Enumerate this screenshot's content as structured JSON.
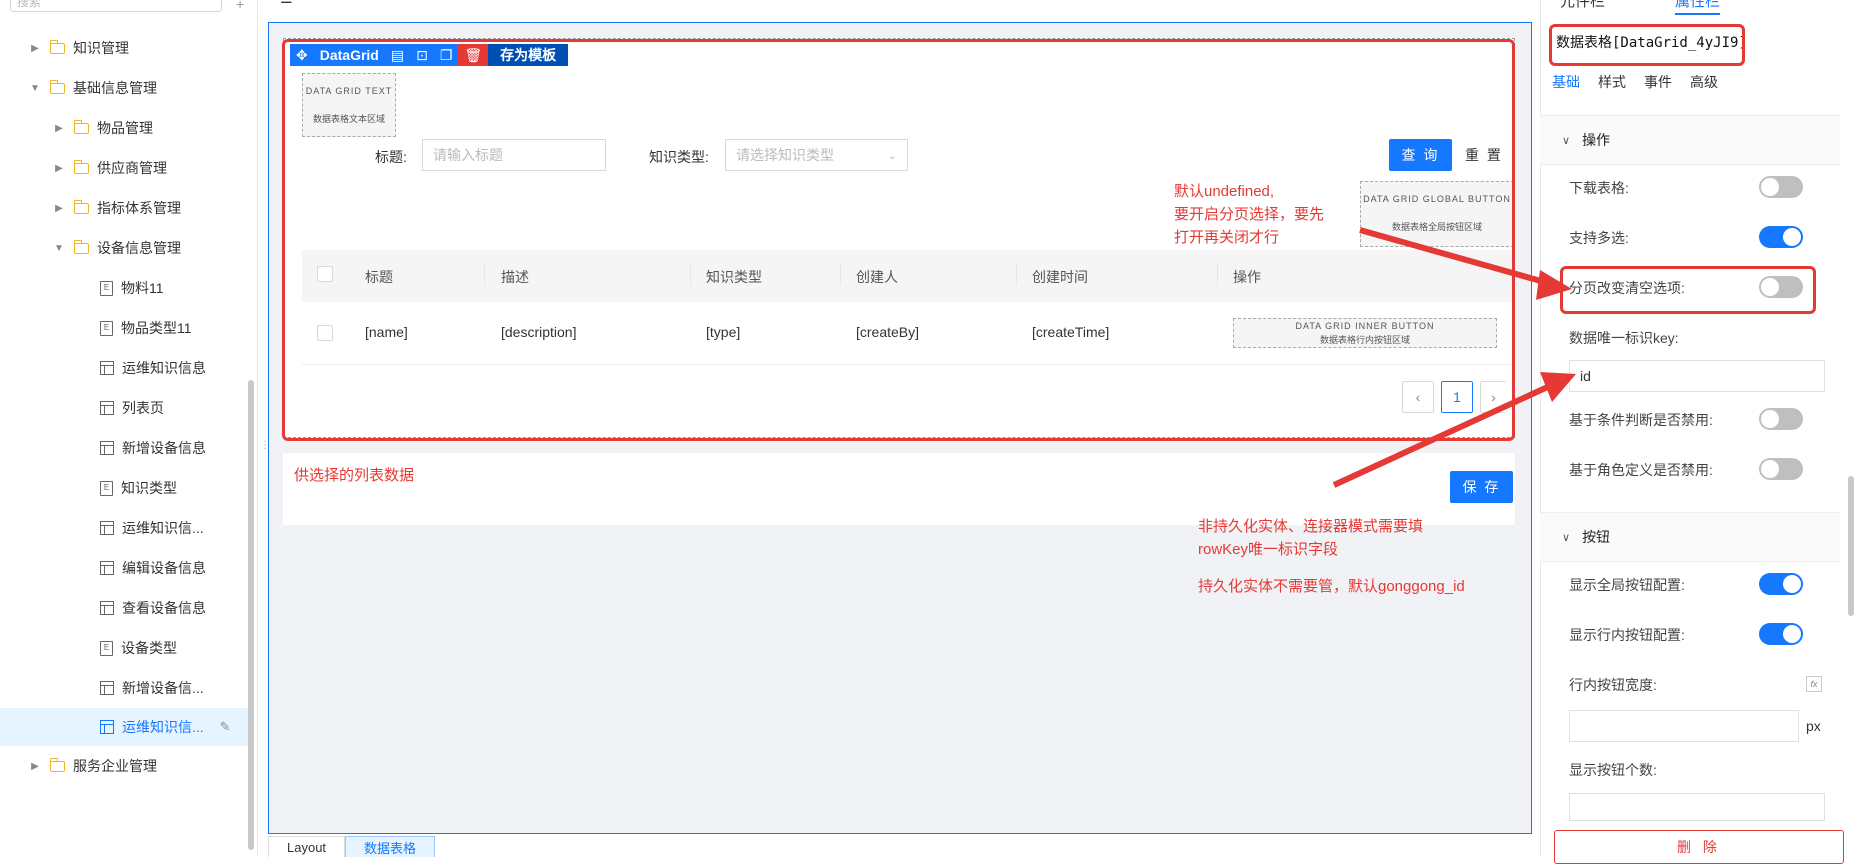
{
  "tree": {
    "search_placeholder": "搜索",
    "add_symbol": "+",
    "items": [
      {
        "label": "知识管理",
        "arrow": "▶",
        "type": "folder"
      },
      {
        "label": "基础信息管理",
        "arrow": "▼",
        "type": "folder"
      },
      {
        "label": "物品管理",
        "arrow": "▶",
        "type": "folder"
      },
      {
        "label": "供应商管理",
        "arrow": "▶",
        "type": "folder"
      },
      {
        "label": "指标体系管理",
        "arrow": "▶",
        "type": "folder"
      },
      {
        "label": "设备信息管理",
        "arrow": "▼",
        "type": "folder"
      },
      {
        "label": "物料11",
        "type": "entity"
      },
      {
        "label": "物品类型11",
        "type": "entity"
      },
      {
        "label": "运维知识信息",
        "type": "page"
      },
      {
        "label": "列表页",
        "type": "page"
      },
      {
        "label": "新增设备信息",
        "type": "page"
      },
      {
        "label": "知识类型",
        "type": "entity"
      },
      {
        "label": "运维知识信...",
        "type": "page"
      },
      {
        "label": "编辑设备信息",
        "type": "page"
      },
      {
        "label": "查看设备信息",
        "type": "page"
      },
      {
        "label": "设备类型",
        "type": "entity"
      },
      {
        "label": "新增设备信...",
        "type": "page"
      },
      {
        "label": "运维知识信...",
        "type": "page",
        "selected": true
      },
      {
        "label": "服务企业管理",
        "arrow": "▶",
        "type": "folder"
      }
    ]
  },
  "datagrid": {
    "component_name": "DataGrid",
    "save_template": "存为模板",
    "text_area_title": "DATA GRID TEXT",
    "text_area_desc": "数据表格文本区域",
    "global_btn_title": "DATA GRID GLOBAL BUTTON",
    "global_btn_desc": "数据表格全局按钮区域",
    "inner_btn_title": "DATA GRID INNER BUTTON",
    "inner_btn_desc": "数据表格行内按钮区域",
    "filter": {
      "title_label": "标题:",
      "title_placeholder": "请输入标题",
      "type_label": "知识类型:",
      "type_placeholder": "请选择知识类型",
      "query_button": "查 询",
      "reset_button": "重 置"
    },
    "columns": [
      "标题",
      "描述",
      "知识类型",
      "创建人",
      "创建时间",
      "操作"
    ],
    "row": [
      "[name]",
      "[description]",
      "[type]",
      "[createBy]",
      "[createTime]"
    ],
    "pager": {
      "prev": "‹",
      "current": "1",
      "next": "›"
    }
  },
  "form2": {
    "title": "供选择的列表数据",
    "save_button": "保 存"
  },
  "notes": {
    "note1": [
      "默认undefined,",
      "要开启分页选择，要先",
      "打开再关闭才行"
    ],
    "note2": [
      "非持久化实体、连接器模式需要填",
      "rowKey唯一标识字段"
    ],
    "note3": "持久化实体不需要管，默认gonggong_id"
  },
  "bottom_tabs": [
    "Layout",
    "数据表格"
  ],
  "panel": {
    "tabs": [
      "元件栏",
      "属性栏"
    ],
    "component_title": "数据表格[DataGrid_4yJI9]",
    "subtabs": [
      "基础",
      "样式",
      "事件",
      "高级"
    ],
    "section_ops": "操作",
    "section_buttons": "按钮",
    "props": {
      "download": "下载表格:",
      "multi_select": "支持多选:",
      "page_clear": "分页改变清空选项:",
      "row_key_label": "数据唯一标识key:",
      "row_key_value": "id",
      "cond_disable": "基于条件判断是否禁用:",
      "role_disable": "基于角色定义是否禁用:",
      "show_global_btn": "显示全局按钮配置:",
      "show_inner_btn": "显示行内按钮配置:",
      "inner_btn_width": "行内按钮宽度:",
      "px_unit": "px",
      "show_btn_count": "显示按钮个数:"
    },
    "delete_button": "删 除"
  },
  "colors": {
    "primary": "#1677ff",
    "annotation": "#e53935",
    "folder": "#f0b429"
  }
}
